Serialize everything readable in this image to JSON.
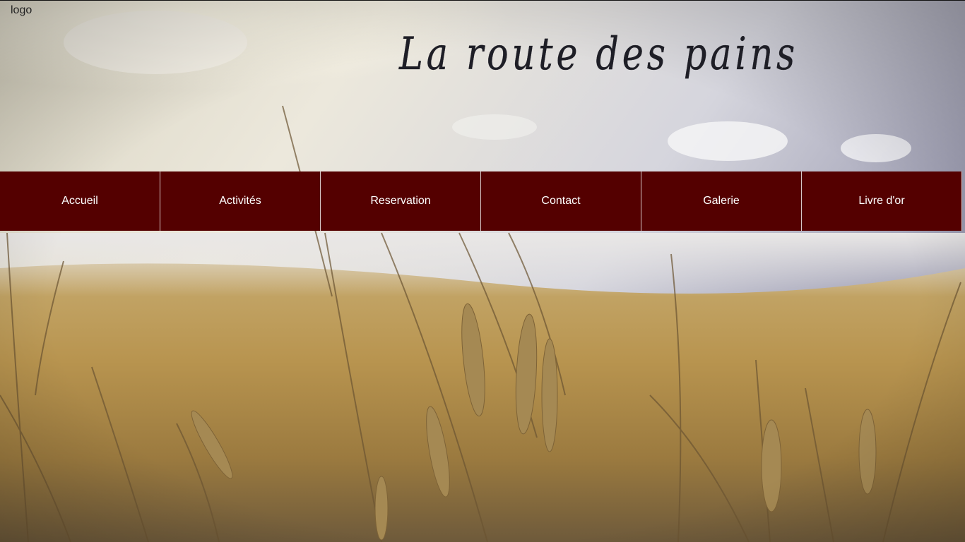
{
  "header": {
    "logo_alt_text": "logo",
    "site_title": "La route des pains"
  },
  "nav": {
    "items": [
      {
        "label": "Accueil"
      },
      {
        "label": "Activités"
      },
      {
        "label": "Reservation"
      },
      {
        "label": "Contact"
      },
      {
        "label": "Galerie"
      },
      {
        "label": "Livre d'or"
      }
    ]
  },
  "colors": {
    "nav_background": "#540000",
    "nav_text": "#ffffff",
    "nav_divider": "#d8c8c8",
    "title_ink": "#1e1e26"
  },
  "background": {
    "subject": "wheat field under cloudy sky"
  }
}
